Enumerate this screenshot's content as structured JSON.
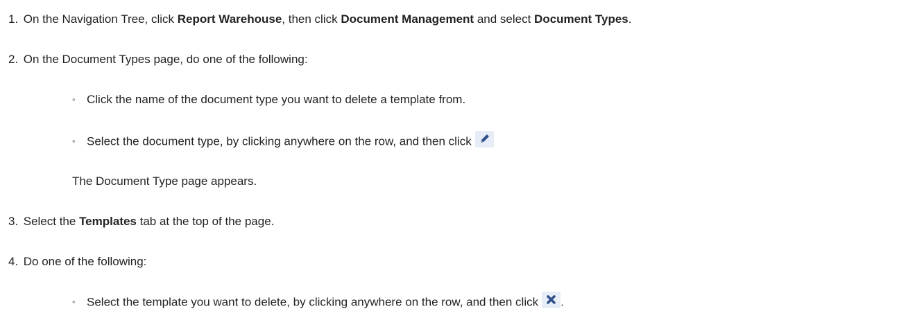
{
  "steps": [
    {
      "number": "1.",
      "pre": "On the Navigation Tree, click ",
      "bold1": "Report Warehouse",
      "mid1": ", then click ",
      "bold2": "Document Management",
      "mid2": " and select ",
      "bold3": "Document Types",
      "post": "."
    },
    {
      "number": "2.",
      "text": "On the Document Types page, do one of the following:",
      "bullets": [
        {
          "marker": "◦",
          "text": "Click the name of the document type you want to delete a template from."
        },
        {
          "marker": "◦",
          "text": "Select the document type, by clicking anywhere on the row, and then click",
          "icon": "edit-pencil-icon"
        }
      ],
      "result": "The Document Type page appears."
    },
    {
      "number": "3.",
      "pre": "Select the ",
      "bold": "Templates",
      "post": " tab at the top of the page."
    },
    {
      "number": "4.",
      "text": "Do one of the following:",
      "bullets": [
        {
          "marker": "◦",
          "text": "Select the template you want to delete, by clicking anywhere on the row, and then click",
          "icon": "delete-x-icon",
          "post": "."
        }
      ]
    }
  ],
  "colors": {
    "text": "#222222",
    "icon_bg": "#e6edf7",
    "icon_fg": "#2f4f8a"
  }
}
